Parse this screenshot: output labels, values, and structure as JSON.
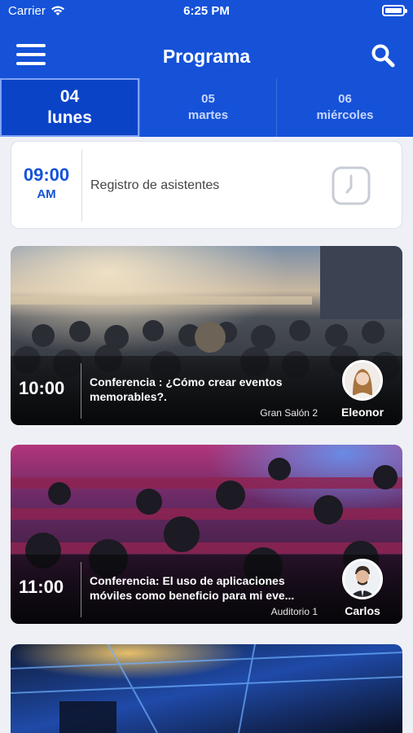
{
  "status_bar": {
    "carrier": "Carrier",
    "time": "6:25 PM"
  },
  "header": {
    "title": "Programa"
  },
  "days": [
    {
      "num": "04",
      "name": "lunes",
      "active": true
    },
    {
      "num": "05",
      "name": "martes",
      "active": false
    },
    {
      "num": "06",
      "name": "miércoles",
      "active": false
    }
  ],
  "registration": {
    "time": "09:00",
    "ampm": "AM",
    "title": "Registro de asistentes"
  },
  "events": [
    {
      "time": "10:00",
      "title": "Conferencia : ¿Cómo crear eventos memorables?.",
      "room": "Gran Salón 2",
      "speaker": "Eleonor"
    },
    {
      "time": "11:00",
      "title": "Conferencia: El uso de aplicaciones móviles como beneficio para mi eve...",
      "room": "Auditorio 1",
      "speaker": "Carlos"
    }
  ],
  "colors": {
    "primary": "#1552d8",
    "accent_time": "#1552d8",
    "background": "#eef0f5"
  },
  "icons": [
    "menu-icon",
    "search-icon",
    "clock-icon",
    "wifi-icon",
    "battery-icon"
  ]
}
